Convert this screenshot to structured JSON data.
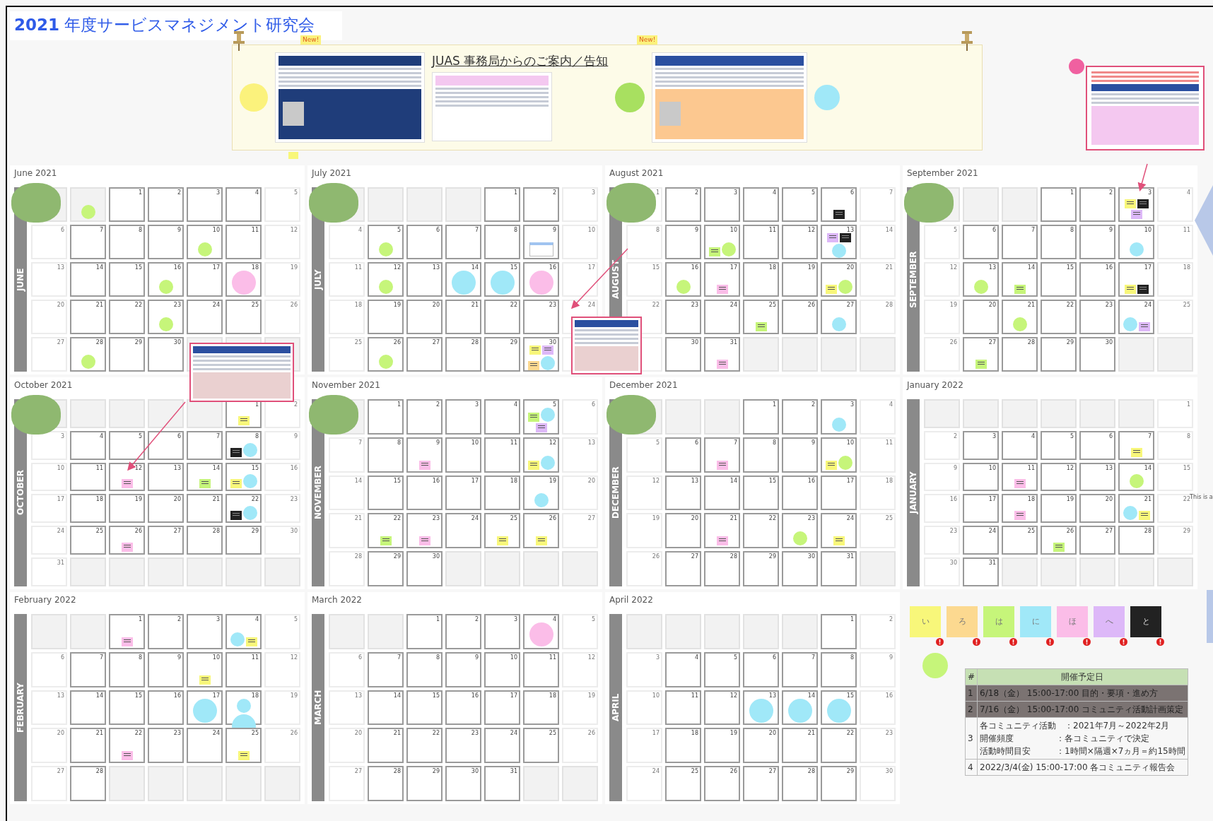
{
  "title": "**2021** 年度サービスマネジメント研究会",
  "banner": {
    "heading": "JUAS 事務局からのご案内／告知",
    "new_badges": [
      "New!",
      "New!"
    ]
  },
  "side_note": "This is a",
  "months": [
    {
      "title": "June 2021",
      "label": "JUNE",
      "illustration": true,
      "weeks": [
        [
          {
            "outside": true
          },
          {
            "outside": true,
            "events": [
              {
                "kind": "circle",
                "color": "#c6f57a"
              }
            ]
          },
          {
            "day": "1"
          },
          {
            "day": "2"
          },
          {
            "day": "3"
          },
          {
            "day": "4"
          },
          {
            "day": "5"
          }
        ],
        [
          {
            "day": "6"
          },
          {
            "day": "7"
          },
          {
            "day": "8"
          },
          {
            "day": "9"
          },
          {
            "day": "10",
            "events": [
              {
                "kind": "circle",
                "color": "#c6f57a"
              }
            ]
          },
          {
            "day": "11"
          },
          {
            "day": "12"
          }
        ],
        [
          {
            "day": "13"
          },
          {
            "day": "14"
          },
          {
            "day": "15"
          },
          {
            "day": "16",
            "events": [
              {
                "kind": "circle",
                "color": "#c6f57a"
              }
            ]
          },
          {
            "day": "17"
          },
          {
            "day": "18",
            "events": [
              {
                "kind": "bubble",
                "color": "#fbbde8"
              }
            ]
          },
          {
            "day": "19"
          }
        ],
        [
          {
            "day": "20"
          },
          {
            "day": "21"
          },
          {
            "day": "22"
          },
          {
            "day": "23",
            "events": [
              {
                "kind": "circle",
                "color": "#c6f57a"
              }
            ]
          },
          {
            "day": "24"
          },
          {
            "day": "25"
          },
          {
            "day": "26"
          }
        ],
        [
          {
            "day": "27"
          },
          {
            "day": "28",
            "events": [
              {
                "kind": "circle",
                "color": "#c6f57a"
              }
            ]
          },
          {
            "day": "29"
          },
          {
            "day": "30"
          },
          {
            "outside": true
          },
          {
            "outside": true
          },
          {
            "outside": true
          }
        ]
      ]
    },
    {
      "title": "July 2021",
      "label": "JULY",
      "illustration": true,
      "weeks": [
        [
          {
            "outside": true
          },
          {
            "outside": true
          },
          {
            "outside": true
          },
          {
            "outside": true
          },
          {
            "day": "1"
          },
          {
            "day": "2"
          },
          {
            "day": "3"
          }
        ],
        [
          {
            "day": "4"
          },
          {
            "day": "5",
            "events": [
              {
                "kind": "circle",
                "color": "#c6f57a"
              }
            ]
          },
          {
            "day": "6"
          },
          {
            "day": "7"
          },
          {
            "day": "8"
          },
          {
            "day": "9",
            "events": [
              {
                "kind": "flyer",
                "color": "#a0c4f0"
              }
            ]
          },
          {
            "day": "10"
          }
        ],
        [
          {
            "day": "11"
          },
          {
            "day": "12",
            "events": [
              {
                "kind": "circle",
                "color": "#c6f57a"
              }
            ]
          },
          {
            "day": "13"
          },
          {
            "day": "14",
            "events": [
              {
                "kind": "bubble",
                "color": "#a0e8f8"
              }
            ]
          },
          {
            "day": "15",
            "events": [
              {
                "kind": "bubble",
                "color": "#a0e8f8"
              }
            ]
          },
          {
            "day": "16",
            "events": [
              {
                "kind": "bubble",
                "color": "#fbbde8"
              }
            ]
          },
          {
            "day": "17"
          }
        ],
        [
          {
            "day": "18"
          },
          {
            "day": "19"
          },
          {
            "day": "20"
          },
          {
            "day": "21"
          },
          {
            "day": "22"
          },
          {
            "day": "23"
          },
          {
            "day": "24"
          }
        ],
        [
          {
            "day": "25"
          },
          {
            "day": "26",
            "events": [
              {
                "kind": "circle",
                "color": "#c6f57a"
              }
            ]
          },
          {
            "day": "27"
          },
          {
            "day": "28"
          },
          {
            "day": "29"
          },
          {
            "day": "30",
            "events": [
              {
                "kind": "note",
                "color": "#f8f77a"
              },
              {
                "kind": "note",
                "color": "#ddb8f8"
              },
              {
                "kind": "note",
                "color": "#fcd990"
              },
              {
                "kind": "circle",
                "color": "#a0e8f8"
              }
            ]
          },
          {
            "outside": false
          }
        ]
      ]
    },
    {
      "title": "August 2021",
      "label": "AUGUST",
      "illustration": true,
      "weeks": [
        [
          {
            "day": "1"
          },
          {
            "day": "2"
          },
          {
            "day": "3"
          },
          {
            "day": "4"
          },
          {
            "day": "5"
          },
          {
            "day": "6",
            "events": [
              {
                "kind": "note",
                "color": "#222222"
              }
            ]
          },
          {
            "day": "7"
          }
        ],
        [
          {
            "day": "8"
          },
          {
            "day": "9"
          },
          {
            "day": "10",
            "events": [
              {
                "kind": "note",
                "color": "#c6f57a"
              },
              {
                "kind": "circle",
                "color": "#c6f57a"
              }
            ]
          },
          {
            "day": "11"
          },
          {
            "day": "12"
          },
          {
            "day": "13",
            "events": [
              {
                "kind": "note",
                "color": "#ddb8f8"
              },
              {
                "kind": "note",
                "color": "#222222"
              },
              {
                "kind": "circle",
                "color": "#a0e8f8"
              }
            ]
          },
          {
            "day": "14"
          }
        ],
        [
          {
            "day": "15"
          },
          {
            "day": "16",
            "events": [
              {
                "kind": "circle",
                "color": "#c6f57a"
              }
            ]
          },
          {
            "day": "17",
            "events": [
              {
                "kind": "note",
                "color": "#fbbde8"
              }
            ]
          },
          {
            "day": "18"
          },
          {
            "day": "19"
          },
          {
            "day": "20",
            "events": [
              {
                "kind": "note",
                "color": "#f8f77a"
              },
              {
                "kind": "circle",
                "color": "#c6f57a"
              }
            ]
          },
          {
            "day": "21"
          }
        ],
        [
          {
            "day": "22"
          },
          {
            "day": "23"
          },
          {
            "day": "24"
          },
          {
            "day": "25",
            "events": [
              {
                "kind": "note",
                "color": "#c6f57a"
              }
            ]
          },
          {
            "day": "26"
          },
          {
            "day": "27",
            "events": [
              {
                "kind": "circle",
                "color": "#a0e8f8"
              }
            ]
          },
          {
            "day": "28"
          }
        ],
        [
          {
            "outside": false
          },
          {
            "day": "30"
          },
          {
            "day": "31",
            "events": [
              {
                "kind": "note",
                "color": "#fbbde8"
              }
            ]
          },
          {
            "outside": true
          },
          {
            "outside": true
          },
          {
            "outside": true
          },
          {
            "outside": true
          }
        ]
      ]
    },
    {
      "title": "September 2021",
      "label": "SEPTEMBER",
      "illustration": true,
      "weeks": [
        [
          {
            "outside": true
          },
          {
            "outside": true
          },
          {
            "outside": true
          },
          {
            "day": "1"
          },
          {
            "day": "2"
          },
          {
            "day": "3",
            "events": [
              {
                "kind": "note",
                "color": "#f8f77a"
              },
              {
                "kind": "note",
                "color": "#222222"
              },
              {
                "kind": "note",
                "color": "#ddb8f8"
              }
            ]
          },
          {
            "day": "4"
          }
        ],
        [
          {
            "day": "5"
          },
          {
            "day": "6"
          },
          {
            "day": "7"
          },
          {
            "day": "8"
          },
          {
            "day": "9"
          },
          {
            "day": "10",
            "events": [
              {
                "kind": "circle",
                "color": "#a0e8f8"
              }
            ]
          },
          {
            "day": "11"
          }
        ],
        [
          {
            "day": "12"
          },
          {
            "day": "13",
            "events": [
              {
                "kind": "circle",
                "color": "#c6f57a"
              }
            ]
          },
          {
            "day": "14",
            "events": [
              {
                "kind": "note",
                "color": "#c6f57a"
              }
            ]
          },
          {
            "day": "15"
          },
          {
            "day": "16"
          },
          {
            "day": "17",
            "events": [
              {
                "kind": "note",
                "color": "#f8f77a"
              },
              {
                "kind": "note",
                "color": "#222222"
              }
            ]
          },
          {
            "day": "18"
          }
        ],
        [
          {
            "day": "19"
          },
          {
            "day": "20"
          },
          {
            "day": "21",
            "events": [
              {
                "kind": "circle",
                "color": "#c6f57a"
              }
            ]
          },
          {
            "day": "22"
          },
          {
            "day": "23"
          },
          {
            "day": "24",
            "events": [
              {
                "kind": "circle",
                "color": "#a0e8f8"
              },
              {
                "kind": "note",
                "color": "#ddb8f8"
              }
            ]
          },
          {
            "day": "25"
          }
        ],
        [
          {
            "day": "26"
          },
          {
            "day": "27",
            "events": [
              {
                "kind": "note",
                "color": "#c6f57a"
              }
            ]
          },
          {
            "day": "28"
          },
          {
            "day": "29"
          },
          {
            "day": "30"
          },
          {
            "outside": true
          },
          {
            "outside": true
          }
        ]
      ]
    },
    {
      "title": "October 2021",
      "label": "OCTOBER",
      "illustration": true,
      "weeks": [
        [
          {
            "outside": true
          },
          {
            "outside": true
          },
          {
            "outside": true
          },
          {
            "outside": true
          },
          {
            "outside": true
          },
          {
            "day": "1",
            "events": [
              {
                "kind": "note",
                "color": "#f8f77a"
              }
            ]
          },
          {
            "day": "2"
          }
        ],
        [
          {
            "day": "3"
          },
          {
            "day": "4"
          },
          {
            "day": "5"
          },
          {
            "day": "6"
          },
          {
            "day": "7"
          },
          {
            "day": "8",
            "events": [
              {
                "kind": "note",
                "color": "#222222"
              },
              {
                "kind": "circle",
                "color": "#a0e8f8"
              }
            ]
          },
          {
            "day": "9"
          }
        ],
        [
          {
            "day": "10"
          },
          {
            "day": "11"
          },
          {
            "day": "12",
            "events": [
              {
                "kind": "note",
                "color": "#fbbde8"
              }
            ]
          },
          {
            "day": "13"
          },
          {
            "day": "14",
            "events": [
              {
                "kind": "note",
                "color": "#c6f57a"
              }
            ]
          },
          {
            "day": "15",
            "events": [
              {
                "kind": "note",
                "color": "#f8f77a"
              },
              {
                "kind": "circle",
                "color": "#a0e8f8"
              }
            ]
          },
          {
            "day": "16"
          }
        ],
        [
          {
            "day": "17"
          },
          {
            "day": "18"
          },
          {
            "day": "19"
          },
          {
            "day": "20"
          },
          {
            "day": "21"
          },
          {
            "day": "22",
            "events": [
              {
                "kind": "note",
                "color": "#222222"
              },
              {
                "kind": "circle",
                "color": "#a0e8f8"
              }
            ]
          },
          {
            "day": "23"
          }
        ],
        [
          {
            "day": "24"
          },
          {
            "day": "25"
          },
          {
            "day": "26",
            "events": [
              {
                "kind": "note",
                "color": "#fbbde8"
              }
            ]
          },
          {
            "day": "27"
          },
          {
            "day": "28"
          },
          {
            "day": "29"
          },
          {
            "day": "30"
          }
        ],
        [
          {
            "day": "31"
          },
          {
            "outside": true
          },
          {
            "outside": true
          },
          {
            "outside": true
          },
          {
            "outside": true
          },
          {
            "outside": true
          },
          {
            "outside": true
          }
        ]
      ]
    },
    {
      "title": "November 2021",
      "label": "NOVEMBER",
      "illustration": true,
      "weeks": [
        [
          {
            "outside": true
          },
          {
            "day": "1"
          },
          {
            "day": "2"
          },
          {
            "day": "3"
          },
          {
            "day": "4"
          },
          {
            "day": "5",
            "events": [
              {
                "kind": "note",
                "color": "#c6f57a"
              },
              {
                "kind": "circle",
                "color": "#a0e8f8"
              },
              {
                "kind": "note",
                "color": "#ddb8f8"
              }
            ]
          },
          {
            "day": "6"
          }
        ],
        [
          {
            "day": "7"
          },
          {
            "day": "8"
          },
          {
            "day": "9",
            "events": [
              {
                "kind": "note",
                "color": "#fbbde8"
              }
            ]
          },
          {
            "day": "10"
          },
          {
            "day": "11"
          },
          {
            "day": "12",
            "events": [
              {
                "kind": "note",
                "color": "#f8f77a"
              },
              {
                "kind": "circle",
                "color": "#a0e8f8"
              }
            ]
          },
          {
            "day": "13"
          }
        ],
        [
          {
            "day": "14"
          },
          {
            "day": "15"
          },
          {
            "day": "16"
          },
          {
            "day": "17"
          },
          {
            "day": "18"
          },
          {
            "day": "19",
            "events": [
              {
                "kind": "circle",
                "color": "#a0e8f8"
              }
            ]
          },
          {
            "day": "20"
          }
        ],
        [
          {
            "day": "21"
          },
          {
            "day": "22",
            "events": [
              {
                "kind": "note",
                "color": "#c6f57a"
              }
            ]
          },
          {
            "day": "23",
            "events": [
              {
                "kind": "note",
                "color": "#fbbde8"
              }
            ]
          },
          {
            "day": "24"
          },
          {
            "day": "25",
            "events": [
              {
                "kind": "note",
                "color": "#f8f77a"
              }
            ]
          },
          {
            "day": "26",
            "events": [
              {
                "kind": "note",
                "color": "#f8f77a"
              }
            ]
          },
          {
            "day": "27"
          }
        ],
        [
          {
            "day": "28"
          },
          {
            "day": "29"
          },
          {
            "day": "30"
          },
          {
            "outside": true
          },
          {
            "outside": true
          },
          {
            "outside": true
          },
          {
            "outside": true
          }
        ]
      ]
    },
    {
      "title": "December 2021",
      "label": "DECEMBER",
      "illustration": true,
      "weeks": [
        [
          {
            "outside": true
          },
          {
            "outside": true
          },
          {
            "outside": true
          },
          {
            "day": "1"
          },
          {
            "day": "2"
          },
          {
            "day": "3",
            "events": [
              {
                "kind": "circle",
                "color": "#a0e8f8"
              }
            ]
          },
          {
            "day": "4"
          }
        ],
        [
          {
            "day": "5"
          },
          {
            "day": "6"
          },
          {
            "day": "7",
            "events": [
              {
                "kind": "note",
                "color": "#fbbde8"
              }
            ]
          },
          {
            "day": "8"
          },
          {
            "day": "9"
          },
          {
            "day": "10",
            "events": [
              {
                "kind": "note",
                "color": "#f8f77a"
              },
              {
                "kind": "circle",
                "color": "#c6f57a"
              }
            ]
          },
          {
            "day": "11"
          }
        ],
        [
          {
            "day": "12"
          },
          {
            "day": "13"
          },
          {
            "day": "14"
          },
          {
            "day": "15"
          },
          {
            "day": "16"
          },
          {
            "day": "17"
          },
          {
            "day": "18"
          }
        ],
        [
          {
            "day": "19"
          },
          {
            "day": "20"
          },
          {
            "day": "21",
            "events": [
              {
                "kind": "note",
                "color": "#fbbde8"
              }
            ]
          },
          {
            "day": "22"
          },
          {
            "day": "23",
            "events": [
              {
                "kind": "circle",
                "color": "#c6f57a"
              }
            ]
          },
          {
            "day": "24",
            "events": [
              {
                "kind": "note",
                "color": "#f8f77a"
              }
            ]
          },
          {
            "day": "25"
          }
        ],
        [
          {
            "day": "26"
          },
          {
            "day": "27"
          },
          {
            "day": "28"
          },
          {
            "day": "29"
          },
          {
            "day": "30"
          },
          {
            "day": "31"
          },
          {
            "outside": true
          }
        ]
      ]
    },
    {
      "title": "January 2022",
      "label": "JANUARY",
      "illustration": false,
      "weeks": [
        [
          {
            "outside": true
          },
          {
            "outside": true
          },
          {
            "outside": true
          },
          {
            "outside": true
          },
          {
            "outside": true
          },
          {
            "outside": true
          },
          {
            "day": "1"
          }
        ],
        [
          {
            "day": "2"
          },
          {
            "day": "3"
          },
          {
            "day": "4"
          },
          {
            "day": "5"
          },
          {
            "day": "6"
          },
          {
            "day": "7",
            "events": [
              {
                "kind": "note",
                "color": "#f8f77a"
              }
            ]
          },
          {
            "day": "8"
          }
        ],
        [
          {
            "day": "9"
          },
          {
            "day": "10"
          },
          {
            "day": "11",
            "events": [
              {
                "kind": "note",
                "color": "#fbbde8"
              }
            ]
          },
          {
            "day": "12"
          },
          {
            "day": "13"
          },
          {
            "day": "14",
            "events": [
              {
                "kind": "circle",
                "color": "#c6f57a"
              }
            ]
          },
          {
            "day": "15"
          }
        ],
        [
          {
            "day": "16"
          },
          {
            "day": "17"
          },
          {
            "day": "18",
            "events": [
              {
                "kind": "note",
                "color": "#fbbde8"
              }
            ]
          },
          {
            "day": "19"
          },
          {
            "day": "20"
          },
          {
            "day": "21",
            "events": [
              {
                "kind": "circle",
                "color": "#a0e8f8"
              },
              {
                "kind": "note",
                "color": "#f8f77a"
              }
            ]
          },
          {
            "day": "22"
          }
        ],
        [
          {
            "day": "23"
          },
          {
            "day": "24"
          },
          {
            "day": "25"
          },
          {
            "day": "26",
            "events": [
              {
                "kind": "note",
                "color": "#c6f57a"
              }
            ]
          },
          {
            "day": "27"
          },
          {
            "day": "28"
          },
          {
            "day": "29"
          }
        ],
        [
          {
            "day": "30"
          },
          {
            "day": "31"
          },
          {
            "outside": true
          },
          {
            "outside": true
          },
          {
            "outside": true
          },
          {
            "outside": true
          },
          {
            "outside": true
          }
        ]
      ]
    },
    {
      "title": "February 2022",
      "label": "FEBRUARY",
      "illustration": false,
      "weeks": [
        [
          {
            "outside": true
          },
          {
            "outside": true
          },
          {
            "day": "1",
            "events": [
              {
                "kind": "note",
                "color": "#fbbde8"
              }
            ]
          },
          {
            "day": "2"
          },
          {
            "day": "3"
          },
          {
            "day": "4",
            "events": [
              {
                "kind": "circle",
                "color": "#a0e8f8"
              },
              {
                "kind": "note",
                "color": "#f8f77a"
              }
            ]
          },
          {
            "day": "5"
          }
        ],
        [
          {
            "day": "6"
          },
          {
            "day": "7"
          },
          {
            "day": "8"
          },
          {
            "day": "9"
          },
          {
            "day": "10",
            "events": [
              {
                "kind": "note",
                "color": "#f8f77a"
              }
            ]
          },
          {
            "day": "11"
          },
          {
            "day": "12"
          }
        ],
        [
          {
            "day": "13"
          },
          {
            "day": "14"
          },
          {
            "day": "15"
          },
          {
            "day": "16"
          },
          {
            "day": "17",
            "events": [
              {
                "kind": "bubble",
                "color": "#a0e8f8"
              }
            ]
          },
          {
            "day": "18",
            "events": [
              {
                "kind": "circle",
                "color": "#a0e8f8"
              },
              {
                "kind": "bubble",
                "color": "#a0e8f8"
              }
            ]
          },
          {
            "day": "19"
          }
        ],
        [
          {
            "day": "20"
          },
          {
            "day": "21"
          },
          {
            "day": "22",
            "events": [
              {
                "kind": "note",
                "color": "#fbbde8"
              }
            ]
          },
          {
            "day": "23"
          },
          {
            "day": "24"
          },
          {
            "day": "25",
            "events": [
              {
                "kind": "note",
                "color": "#f8f77a"
              }
            ]
          },
          {
            "day": "26"
          }
        ],
        [
          {
            "day": "27"
          },
          {
            "day": "28"
          },
          {
            "outside": true
          },
          {
            "outside": true
          },
          {
            "outside": true
          },
          {
            "outside": true
          },
          {
            "outside": true
          }
        ]
      ]
    },
    {
      "title": "March 2022",
      "label": "MARCH",
      "illustration": false,
      "weeks": [
        [
          {
            "outside": true
          },
          {
            "outside": true
          },
          {
            "day": "1"
          },
          {
            "day": "2"
          },
          {
            "day": "3"
          },
          {
            "day": "4",
            "events": [
              {
                "kind": "bubble",
                "color": "#fbbde8"
              }
            ]
          },
          {
            "day": "5"
          }
        ],
        [
          {
            "day": "6"
          },
          {
            "day": "7"
          },
          {
            "day": "8"
          },
          {
            "day": "9"
          },
          {
            "day": "10"
          },
          {
            "day": "11"
          },
          {
            "day": "12"
          }
        ],
        [
          {
            "day": "13"
          },
          {
            "day": "14"
          },
          {
            "day": "15"
          },
          {
            "day": "16"
          },
          {
            "day": "17"
          },
          {
            "day": "18"
          },
          {
            "day": "19"
          }
        ],
        [
          {
            "day": "20"
          },
          {
            "day": "21"
          },
          {
            "day": "22"
          },
          {
            "day": "23"
          },
          {
            "day": "24"
          },
          {
            "day": "25"
          },
          {
            "day": "26"
          }
        ],
        [
          {
            "day": "27"
          },
          {
            "day": "28"
          },
          {
            "day": "29"
          },
          {
            "day": "30"
          },
          {
            "day": "31"
          },
          {
            "outside": true
          },
          {
            "outside": true
          }
        ]
      ]
    },
    {
      "title": "April 2022",
      "label": "APRIL",
      "illustration": false,
      "weeks": [
        [
          {
            "outside": true
          },
          {
            "outside": true
          },
          {
            "outside": true
          },
          {
            "outside": true
          },
          {
            "outside": true
          },
          {
            "day": "1"
          },
          {
            "day": "2"
          }
        ],
        [
          {
            "day": "3"
          },
          {
            "day": "4"
          },
          {
            "day": "5"
          },
          {
            "day": "6"
          },
          {
            "day": "7"
          },
          {
            "day": "8"
          },
          {
            "day": "9"
          }
        ],
        [
          {
            "day": "10"
          },
          {
            "day": "11"
          },
          {
            "day": "12"
          },
          {
            "day": "13",
            "events": [
              {
                "kind": "bubble",
                "color": "#a0e8f8"
              }
            ]
          },
          {
            "day": "14",
            "events": [
              {
                "kind": "bubble",
                "color": "#a0e8f8"
              }
            ]
          },
          {
            "day": "15",
            "events": [
              {
                "kind": "bubble",
                "color": "#a0e8f8"
              }
            ]
          },
          {
            "day": "16"
          }
        ],
        [
          {
            "day": "17"
          },
          {
            "day": "18"
          },
          {
            "day": "19"
          },
          {
            "day": "20"
          },
          {
            "day": "21"
          },
          {
            "day": "22"
          },
          {
            "day": "23"
          }
        ],
        [
          {
            "day": "24"
          },
          {
            "day": "25"
          },
          {
            "day": "26"
          },
          {
            "day": "27"
          },
          {
            "day": "28"
          },
          {
            "day": "29"
          },
          {
            "day": "30"
          }
        ]
      ]
    }
  ],
  "legend": {
    "notes": [
      {
        "label": "い",
        "color": "#f8f77a"
      },
      {
        "label": "ろ",
        "color": "#fcd990"
      },
      {
        "label": "は",
        "color": "#c6f57a"
      },
      {
        "label": "に",
        "color": "#a0e8f8"
      },
      {
        "label": "ほ",
        "color": "#fbbde8"
      },
      {
        "label": "へ",
        "color": "#ddb8f8"
      },
      {
        "label": "と",
        "color": "#222222"
      }
    ]
  },
  "schedule": {
    "columns": [
      "#",
      "開催予定日"
    ],
    "rows": [
      {
        "no": "1",
        "lines": [
          "6/18（金） 15:00-17:00 目的・要項・進め方"
        ],
        "done": true
      },
      {
        "no": "2",
        "lines": [
          "7/16（金） 15:00-17:00 コミュニティ活動計画策定"
        ],
        "done": true
      },
      {
        "no": "3",
        "lines": [
          "各コミュニティ活動　：2021年7月～2022年2月",
          "開催頻度　　　　　：各コミュニティで決定",
          "活動時間目安　　　：1時間×隔週×7ヵ月＝約15時間"
        ],
        "done": false
      },
      {
        "no": "4",
        "lines": [
          "2022/3/4(金) 15:00-17:00 各コミュニティ報告会"
        ],
        "done": false
      }
    ]
  }
}
